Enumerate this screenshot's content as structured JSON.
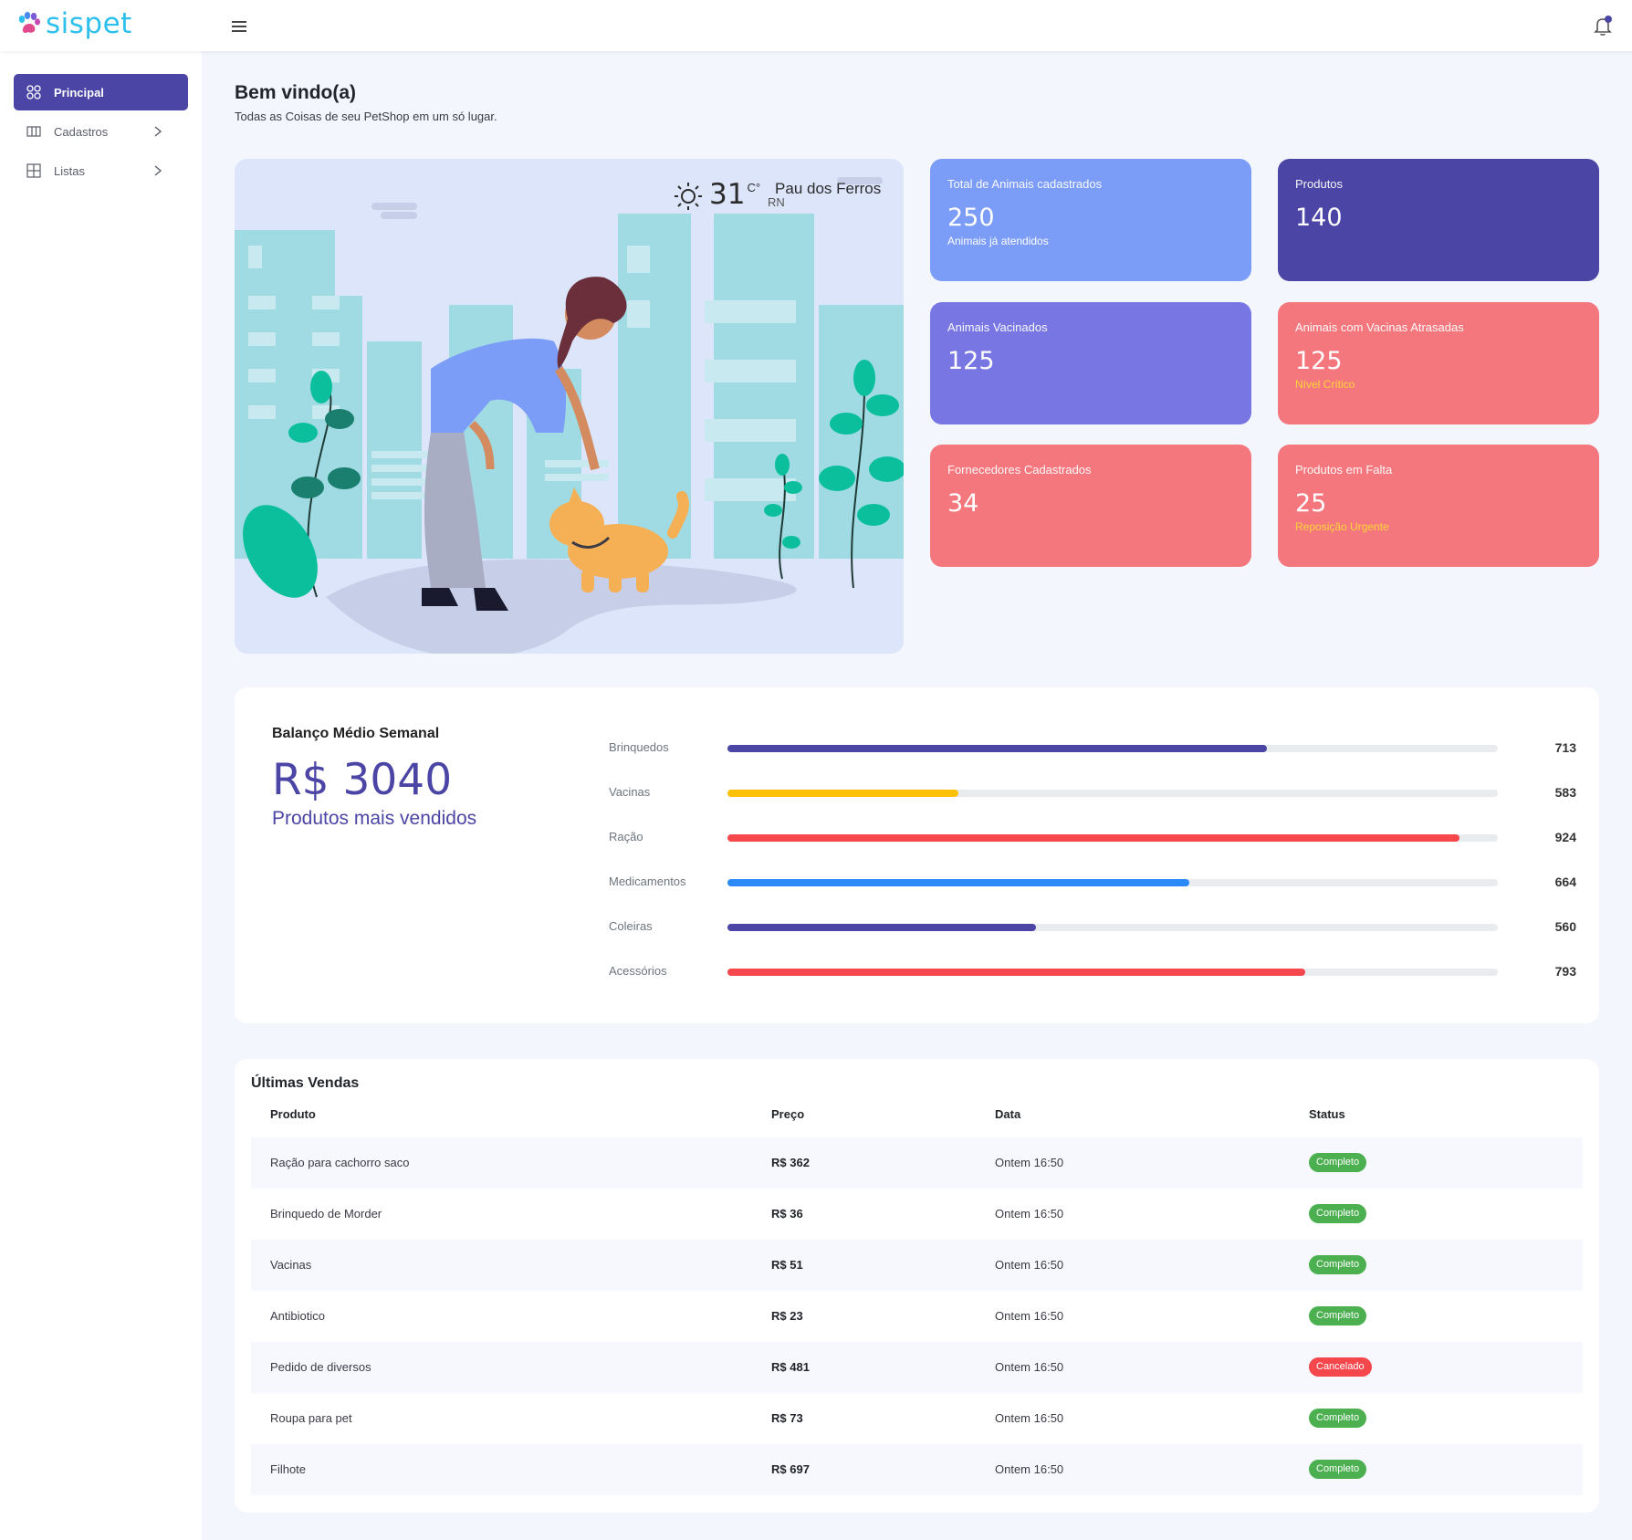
{
  "app": {
    "name": "sispet"
  },
  "sidebar": {
    "items": [
      {
        "label": "Principal",
        "icon": "grid-icon",
        "active": true
      },
      {
        "label": "Cadastros",
        "icon": "columns-icon",
        "active": false
      },
      {
        "label": "Listas",
        "icon": "table-icon",
        "active": false
      }
    ]
  },
  "welcome": {
    "title": "Bem vindo(a)",
    "subtitle": "Todas as Coisas de seu PetShop em um só lugar."
  },
  "weather": {
    "temp": "31",
    "unit": "C°",
    "city": "Pau dos Ferros",
    "state": "RN"
  },
  "stats": [
    {
      "label": "Total de Animais cadastrados",
      "value": "250",
      "sub": "Animais já atendidos",
      "color": "#7b9cf7",
      "sub_color": "#ffffff"
    },
    {
      "label": "Produtos",
      "value": "140",
      "sub": "",
      "color": "#4b45a5",
      "sub_color": "#ffffff"
    },
    {
      "label": "Animais Vacinados",
      "value": "125",
      "sub": "",
      "color": "#7876e3",
      "sub_color": "#ffffff"
    },
    {
      "label": "Animais com Vacinas Atrasadas",
      "value": "125",
      "sub": "Nível Crítico",
      "color": "#f4777d",
      "sub_color": "#ffd43b"
    },
    {
      "label": "Fornecedores Cadastrados",
      "value": "34",
      "sub": "",
      "color": "#f4777d",
      "sub_color": "#ffffff"
    },
    {
      "label": "Produtos em Falta",
      "value": "25",
      "sub": "Reposição Urgente",
      "color": "#f4777d",
      "sub_color": "#ffd43b"
    }
  ],
  "balance": {
    "title": "Balanço Médio Semanal",
    "value": "R$ 3040",
    "subtitle": "Produtos mais vendidos",
    "bars": [
      {
        "name": "Brinquedos",
        "value": "713",
        "fill": 0.7,
        "color": "#4b45a5"
      },
      {
        "name": "Vacinas",
        "value": "583",
        "fill": 0.3,
        "color": "#ffc107"
      },
      {
        "name": "Ração",
        "value": "924",
        "fill": 0.95,
        "color": "#f5474c"
      },
      {
        "name": "Medicamentos",
        "value": "664",
        "fill": 0.6,
        "color": "#2b8af7"
      },
      {
        "name": "Coleiras",
        "value": "560",
        "fill": 0.4,
        "color": "#4b45a5"
      },
      {
        "name": "Acessórios",
        "value": "793",
        "fill": 0.75,
        "color": "#f5474c"
      }
    ]
  },
  "sales": {
    "title": "Últimas Vendas",
    "headers": {
      "product": "Produto",
      "price": "Preço",
      "date": "Data",
      "status": "Status"
    },
    "rows": [
      {
        "product": "Ração para cachorro saco",
        "price": "R$ 362",
        "date": "Ontem 16:50",
        "status": "Completo",
        "status_color": "#4caf50"
      },
      {
        "product": "Brinquedo de Morder",
        "price": "R$ 36",
        "date": "Ontem 16:50",
        "status": "Completo",
        "status_color": "#4caf50"
      },
      {
        "product": "Vacinas",
        "price": "R$ 51",
        "date": "Ontem 16:50",
        "status": "Completo",
        "status_color": "#4caf50"
      },
      {
        "product": "Antibiotico",
        "price": "R$ 23",
        "date": "Ontem 16:50",
        "status": "Completo",
        "status_color": "#4caf50"
      },
      {
        "product": "Pedido de diversos",
        "price": "R$ 481",
        "date": "Ontem 16:50",
        "status": "Cancelado",
        "status_color": "#f5474c"
      },
      {
        "product": "Roupa para pet",
        "price": "R$ 73",
        "date": "Ontem 16:50",
        "status": "Completo",
        "status_color": "#4caf50"
      },
      {
        "product": "Filhote",
        "price": "R$ 697",
        "date": "Ontem 16:50",
        "status": "Completo",
        "status_color": "#4caf50"
      }
    ]
  }
}
